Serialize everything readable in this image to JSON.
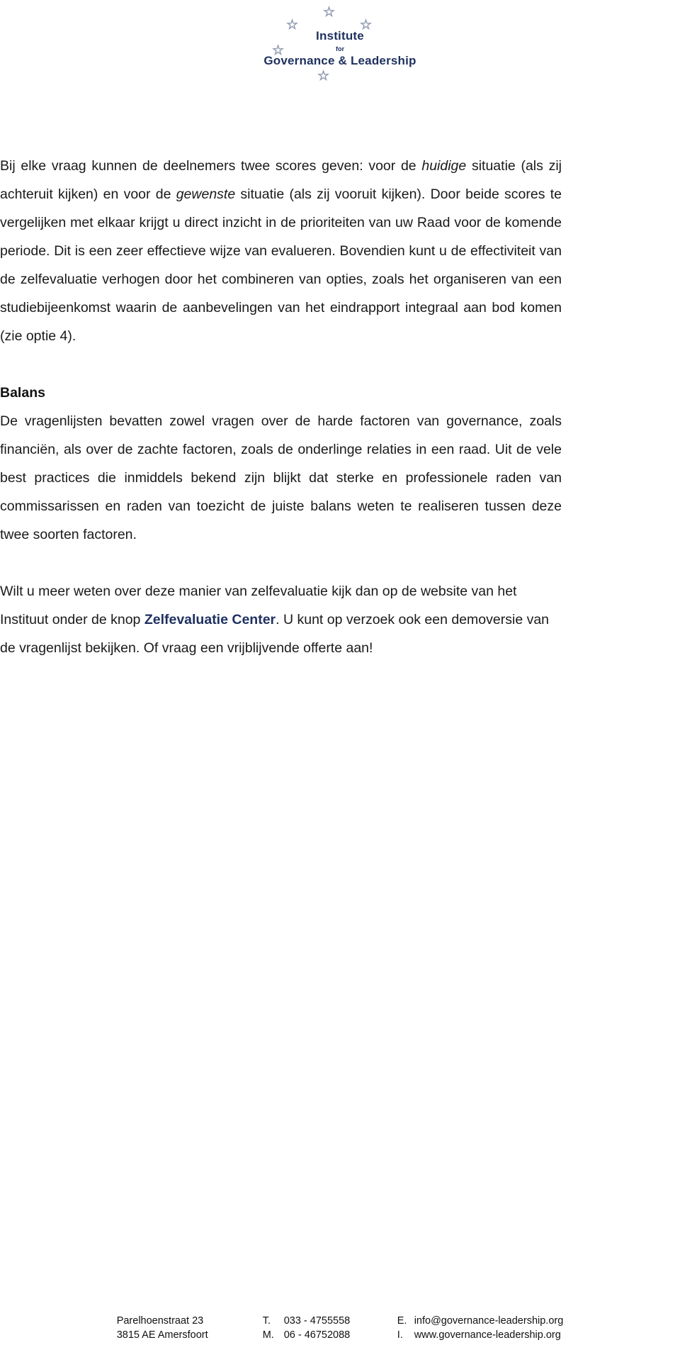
{
  "logo": {
    "line1": "Institute",
    "line2": "for",
    "line3": "Governance & Leadership",
    "star_glyph": "☆",
    "brand_color": "#1f3160"
  },
  "document": {
    "paragraph1": {
      "part1": "Bij elke vraag kunnen de deelnemers twee scores geven: voor de ",
      "italic1": "huidige",
      "part2": " situatie (als zij achteruit kijken) en voor de ",
      "italic2": "gewenste",
      "part3": " situatie (als zij vooruit kijken). Door beide scores te vergelijken met elkaar krijgt u direct inzicht in de prioriteiten van uw Raad voor de komende periode. Dit is een zeer effectieve wijze van evalueren. Bovendien kunt u de effectiviteit van de zelfevaluatie verhogen door het combineren van opties, zoals het organiseren van een studiebijeenkomst waarin de aanbevelingen van het eindrapport integraal aan bod komen (zie optie 4)."
    },
    "heading_balans": "Balans",
    "paragraph2": "De vragenlijsten bevatten zowel vragen over de harde factoren van governance, zoals financiën, als over de zachte factoren, zoals de onderlinge relaties in een raad. Uit de vele best practices die inmiddels bekend zijn blijkt dat sterke en professionele raden van commissarissen en raden van toezicht de juiste balans weten te realiseren tussen deze twee soorten factoren.",
    "paragraph3": {
      "part1": "Wilt u meer weten over deze manier van zelfevaluatie kijk dan op de website van het Instituut onder de knop ",
      "bold_link": "Zelfevaluatie Center",
      "part2": ". U kunt op verzoek ook een demoversie van de vragenlijst bekijken. Of vraag een vrijblijvende offerte aan!"
    }
  },
  "footer": {
    "address_line1": "Parelhoenstraat 23",
    "address_line2": "3815 AE Amersfoort",
    "phone_label": "T.",
    "phone_value": "033 - 4755558",
    "mobile_label": "M.",
    "mobile_value": "06 - 46752088",
    "email_label": "E.",
    "email_value": "info@governance-leadership.org",
    "web_label": "I.",
    "web_value": "www.governance-leadership.org"
  }
}
